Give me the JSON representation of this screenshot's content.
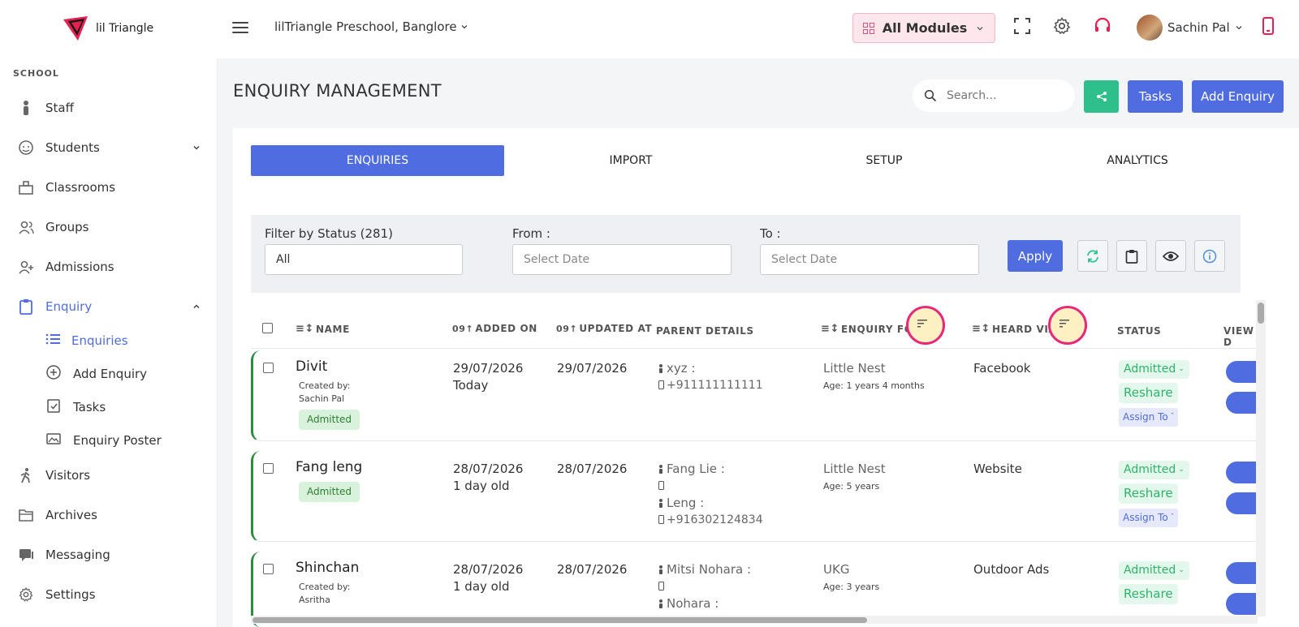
{
  "header": {
    "brand": "lil Triangle",
    "school": "lilTriangle Preschool, Banglore",
    "modules_label": "All Modules",
    "user_name": "Sachin Pal"
  },
  "sidebar": {
    "section": "SCHOOL",
    "items": [
      {
        "label": "Staff"
      },
      {
        "label": "Students"
      },
      {
        "label": "Classrooms"
      },
      {
        "label": "Groups"
      },
      {
        "label": "Admissions"
      },
      {
        "label": "Enquiry"
      },
      {
        "label": "Visitors"
      },
      {
        "label": "Archives"
      },
      {
        "label": "Messaging"
      },
      {
        "label": "Settings"
      }
    ],
    "enquiry_sub": [
      {
        "label": "Enquiries"
      },
      {
        "label": "Add Enquiry"
      },
      {
        "label": "Tasks"
      },
      {
        "label": "Enquiry Poster"
      }
    ]
  },
  "main": {
    "title": "ENQUIRY MANAGEMENT",
    "search_placeholder": "Search...",
    "tasks_label": "Tasks",
    "add_enquiry_label": "Add Enquiry",
    "tabs": [
      {
        "label": "ENQUIRIES"
      },
      {
        "label": "IMPORT"
      },
      {
        "label": "SETUP"
      },
      {
        "label": "ANALYTICS"
      }
    ],
    "filters": {
      "status_label": "Filter by Status (281)",
      "status_value": "All",
      "from_label": "From :",
      "from_placeholder": "Select Date",
      "to_label": "To :",
      "to_placeholder": "Select Date",
      "apply_label": "Apply"
    },
    "columns": [
      "NAME",
      "ADDED ON",
      "UPDATED AT",
      "PARENT DETAILS",
      "ENQUIRY FOR",
      "HEARD VIA",
      "STATUS",
      "VIEW D"
    ],
    "rows": [
      {
        "name": "Divit",
        "created_by_label": "Created by:",
        "created_by": "Sachin Pal",
        "badge": "Admitted",
        "added_date": "29/07/2026",
        "added_age": "Today",
        "updated": "29/07/2026",
        "parent1_name": "xyz :",
        "parent1_phone": "+911111111111",
        "parent2_name": "",
        "parent2_phone": "",
        "enquiry_for": "Little Nest",
        "age": "Age: 1 years 4 months",
        "heard_via": "Facebook",
        "status": "Admitted",
        "reshare": "Reshare",
        "assign": "Assign To"
      },
      {
        "name": "Fang leng",
        "created_by_label": "",
        "created_by": "",
        "badge": "Admitted",
        "added_date": "28/07/2026",
        "added_age": "1 day old",
        "updated": "28/07/2026",
        "parent1_name": "Fang Lie :",
        "parent1_phone": "",
        "parent2_name": "Leng :",
        "parent2_phone": "+916302124834",
        "enquiry_for": "Little Nest",
        "age": "Age: 5 years",
        "heard_via": "Website",
        "status": "Admitted",
        "reshare": "Reshare",
        "assign": "Assign To"
      },
      {
        "name": "Shinchan",
        "created_by_label": "Created by:",
        "created_by": "Asritha",
        "badge": "",
        "added_date": "28/07/2026",
        "added_age": "1 day old",
        "updated": "28/07/2026",
        "parent1_name": "Mitsi Nohara :",
        "parent1_phone": "",
        "parent2_name": "Nohara :",
        "parent2_phone": "",
        "enquiry_for": "UKG",
        "age": "Age: 3 years",
        "heard_via": "Outdoor Ads",
        "status": "Admitted",
        "reshare": "Reshare",
        "assign": ""
      }
    ]
  }
}
